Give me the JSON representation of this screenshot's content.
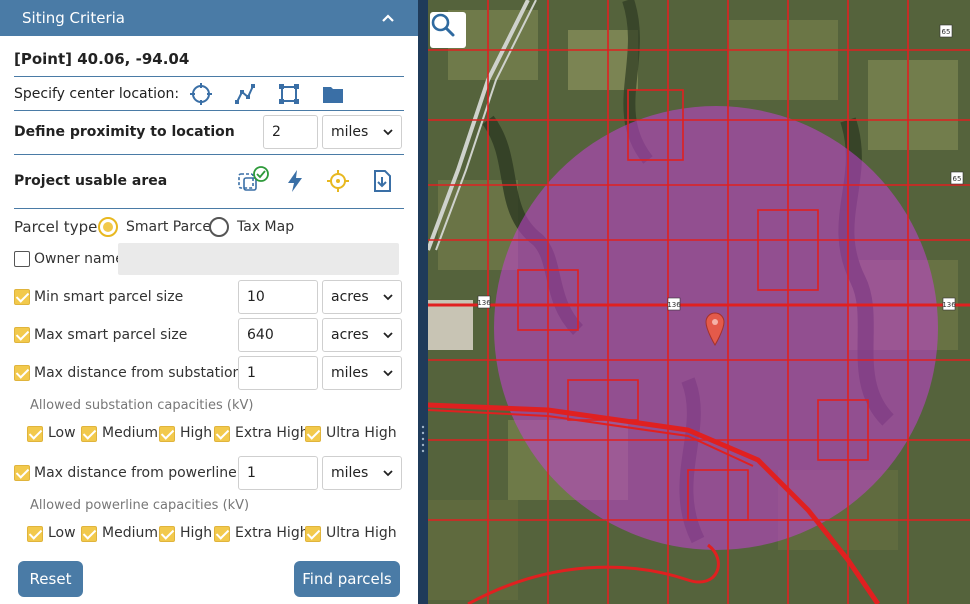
{
  "header": {
    "title": "Siting Criteria",
    "collapse_icon": "chevron-up-icon"
  },
  "point": {
    "title": "[Point] 40.06, -94.04"
  },
  "center_location": {
    "label": "Specify center location:",
    "icons": [
      "crosshair-icon",
      "polyline-icon",
      "polygon-icon",
      "folder-icon"
    ]
  },
  "proximity": {
    "label": "Define proximity to location",
    "value": "2",
    "unit": "miles"
  },
  "usable_area": {
    "label": "Project usable area",
    "icons": [
      "layers-check-icon",
      "lightning-icon",
      "target-icon",
      "download-file-icon"
    ]
  },
  "parcel_type": {
    "label": "Parcel type:",
    "options": [
      "Smart Parcel",
      "Tax Map"
    ],
    "selected": "Smart Parcel"
  },
  "owner": {
    "label": "Owner name",
    "checked": false,
    "value": ""
  },
  "min_size": {
    "label": "Min smart parcel size",
    "checked": true,
    "value": "10",
    "unit": "acres"
  },
  "max_size": {
    "label": "Max smart parcel size",
    "checked": true,
    "value": "640",
    "unit": "acres"
  },
  "substation": {
    "label": "Max distance from substation",
    "checked": true,
    "value": "1",
    "unit": "miles",
    "capacities_label": "Allowed substation capacities (kV)",
    "capacities": [
      "Low",
      "Medium",
      "High",
      "Extra High",
      "Ultra High"
    ]
  },
  "powerline": {
    "label": "Max distance from powerline",
    "checked": true,
    "value": "1",
    "unit": "miles",
    "capacities_label": "Allowed powerline capacities (kV)",
    "capacities": [
      "Low",
      "Medium",
      "High",
      "Extra High",
      "Ultra High"
    ]
  },
  "actions": {
    "reset": "Reset",
    "find": "Find parcels"
  },
  "map": {
    "search_icon": "search-icon",
    "marker_icon": "map-marker-icon",
    "overlay_color": "#c43fd6",
    "parcel_line_color": "#e02020",
    "highway_shields": [
      "136",
      "136",
      "136",
      "136",
      "65",
      "65"
    ]
  },
  "colors": {
    "accent": "#4a7ba6",
    "check": "#f2c94c"
  }
}
